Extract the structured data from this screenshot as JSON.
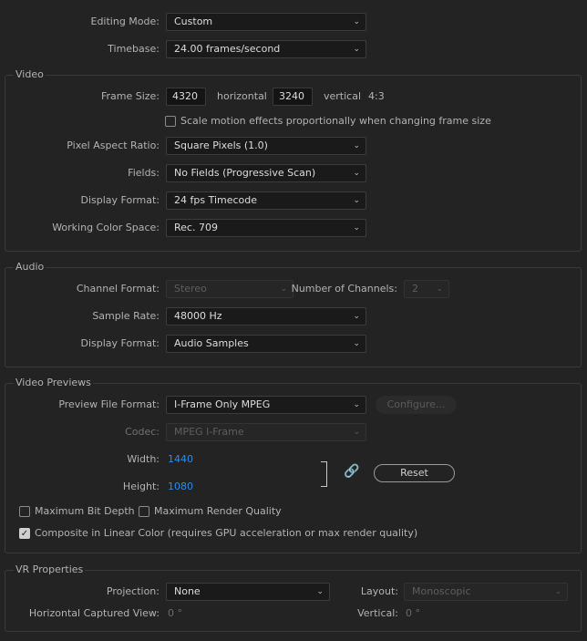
{
  "top": {
    "editing_mode_label": "Editing Mode:",
    "editing_mode_value": "Custom",
    "timebase_label": "Timebase:",
    "timebase_value": "24.00  frames/second"
  },
  "video": {
    "title": "Video",
    "frame_size_label": "Frame Size:",
    "frame_width": "4320",
    "horizontal_label": "horizontal",
    "frame_height": "3240",
    "vertical_label": "vertical",
    "aspect": "4:3",
    "scale_motion_label": "Scale motion effects proportionally when changing frame size",
    "scale_motion_checked": false,
    "pixel_aspect_label": "Pixel Aspect Ratio:",
    "pixel_aspect_value": "Square Pixels (1.0)",
    "fields_label": "Fields:",
    "fields_value": "No Fields (Progressive Scan)",
    "display_format_label": "Display Format:",
    "display_format_value": "24 fps Timecode",
    "working_color_label": "Working Color Space:",
    "working_color_value": "Rec. 709"
  },
  "audio": {
    "title": "Audio",
    "channel_format_label": "Channel Format:",
    "channel_format_value": "Stereo",
    "num_channels_label": "Number of Channels:",
    "num_channels_value": "2",
    "sample_rate_label": "Sample Rate:",
    "sample_rate_value": "48000 Hz",
    "display_format_label": "Display Format:",
    "display_format_value": "Audio Samples"
  },
  "previews": {
    "title": "Video Previews",
    "preview_format_label": "Preview File Format:",
    "preview_format_value": "I-Frame Only MPEG",
    "configure_label": "Configure...",
    "codec_label": "Codec:",
    "codec_value": "MPEG I-Frame",
    "width_label": "Width:",
    "width_value": "1440",
    "height_label": "Height:",
    "height_value": "1080",
    "reset_label": "Reset",
    "max_bit_depth_label": "Maximum Bit Depth",
    "max_bit_depth_checked": false,
    "max_render_quality_label": "Maximum Render Quality",
    "max_render_quality_checked": false,
    "composite_linear_label": "Composite in Linear Color (requires GPU acceleration or max render quality)",
    "composite_linear_checked": true
  },
  "vr": {
    "title": "VR Properties",
    "projection_label": "Projection:",
    "projection_value": "None",
    "layout_label": "Layout:",
    "layout_value": "Monoscopic",
    "h_captured_label": "Horizontal Captured View:",
    "h_captured_value": "0 °",
    "vertical_label": "Vertical:",
    "vertical_value": "0 °"
  },
  "icons": {
    "dropdown": "chevron-down-icon",
    "check": "checkmark-icon",
    "link": "link-icon"
  }
}
